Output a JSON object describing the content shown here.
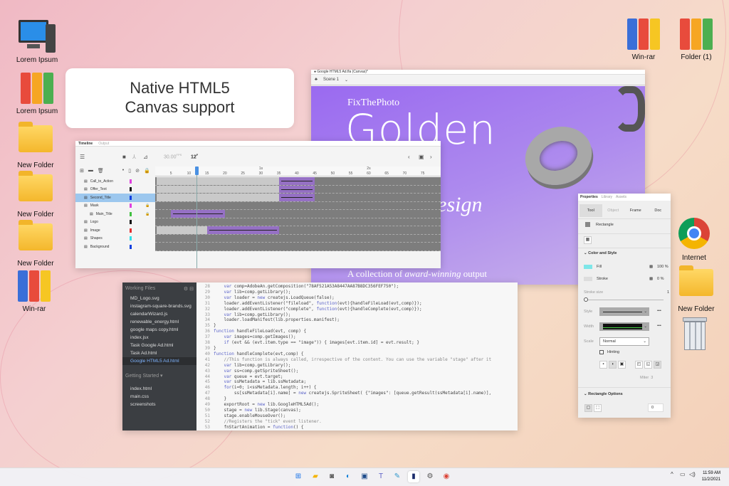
{
  "desktop": {
    "left_icons": [
      {
        "label": "Lorem Ipsum",
        "icon": "monitor-icon"
      },
      {
        "label": "Lorem Ipsum",
        "icon": "binders-icon"
      },
      {
        "label": "New Folder",
        "icon": "folder-icon"
      },
      {
        "label": "New Folder",
        "icon": "folder-icon"
      },
      {
        "label": "New Folder",
        "icon": "folder-icon"
      },
      {
        "label": "Win-rar",
        "icon": "winrar-icon"
      }
    ],
    "right_icons": [
      {
        "label": "Win-rar",
        "icon": "winrar-icon"
      },
      {
        "label": "Folder (1)",
        "icon": "binders-icon"
      },
      {
        "label": "Internet",
        "icon": "chrome-icon"
      },
      {
        "label": "New Folder",
        "icon": "folder-icon"
      },
      {
        "label": "",
        "icon": "trash-icon"
      }
    ]
  },
  "callout": {
    "line1": "Native HTML5",
    "line2": "Canvas support"
  },
  "canvas_window": {
    "title": "Google HTML5 Ad.fla (Canvas)*",
    "scene": "Scene 1",
    "art": {
      "brand": "FixThePhoto",
      "title1": "Golden",
      "title2": "Go",
      "title3": "Graphic Design",
      "subtitle_a": "A collection of ",
      "subtitle_b": "award-winning",
      "subtitle_c": " output"
    }
  },
  "timeline": {
    "tabs": [
      "Timeline",
      "Output"
    ],
    "fps": "30.00",
    "fps_unit": "FPS",
    "frame": "12",
    "frame_unit": "F",
    "current_frame": 12,
    "ruler_ticks": [
      5,
      10,
      15,
      20,
      25,
      30,
      35,
      40,
      45,
      50,
      55,
      60,
      65,
      70,
      75
    ],
    "seconds": [
      "1s",
      "2s"
    ],
    "layers": [
      {
        "name": "Call_to_Action",
        "color": "#e040e0",
        "light": [
          1,
          34
        ],
        "tween": [
          35,
          44
        ]
      },
      {
        "name": "Offer_Text",
        "color": "#111111",
        "light": [
          1,
          34
        ],
        "tween": [
          35,
          44
        ]
      },
      {
        "name": "Second_Title",
        "color": "#1040e0",
        "light": [
          1,
          34
        ],
        "tween": [
          35,
          44
        ],
        "selected": true
      },
      {
        "name": "Mask",
        "color": "#e040e0",
        "locked": true
      },
      {
        "name": "Main_Title",
        "color": "#40c040",
        "locked": true,
        "tween": [
          5,
          19
        ],
        "indent": true
      },
      {
        "name": "Logo",
        "color": "#111111"
      },
      {
        "name": "Image",
        "color": "#e03030",
        "light": [
          1,
          14
        ],
        "tween": [
          15,
          34
        ]
      },
      {
        "name": "Shapes",
        "color": "#30e0e8"
      },
      {
        "name": "Background",
        "color": "#1040e0"
      }
    ]
  },
  "code_editor": {
    "working_files_label": "Working Files",
    "files": [
      "MD_Logo.svg",
      "instagram-square-brands.svg",
      "calendarWizard.js",
      "renewable_energy.html",
      "google maps copy.html",
      "index.jsx",
      "Task Google Ad.html",
      "Task Ad.html",
      "Google HTML5 Ad.html"
    ],
    "selected_file": "Google HTML5 Ad.html",
    "getting_started_label": "Getting Started",
    "project_files": [
      "index.html",
      "main.css",
      "screenshots"
    ],
    "lines": [
      {
        "n": "28",
        "t": "    var comp=AdobeAn.getComposition(\"78AF521A53A8447AA87B8DC356FEF750\");"
      },
      {
        "n": "29",
        "t": "    var lib=comp.getLibrary();"
      },
      {
        "n": "30",
        "t": "    var loader = new createjs.LoadQueue(false);"
      },
      {
        "n": "31",
        "t": "    loader.addEventListener(\"fileload\", function(evt){handleFileLoad(evt,comp)});"
      },
      {
        "n": "32",
        "t": "    loader.addEventListener(\"complete\", function(evt){handleComplete(evt,comp)});"
      },
      {
        "n": "33",
        "t": "    var lib=comp.getLibrary();"
      },
      {
        "n": "34",
        "t": "    loader.loadManifest(lib.properties.manifest);"
      },
      {
        "n": "35",
        "t": "}"
      },
      {
        "n": "36",
        "t": "function handleFileLoad(evt, comp) {"
      },
      {
        "n": "37",
        "t": "    var images=comp.getImages();"
      },
      {
        "n": "38",
        "t": "    if (evt && (evt.item.type == \"image\")) { images[evt.item.id] = evt.result; }"
      },
      {
        "n": "39",
        "t": "}"
      },
      {
        "n": "40",
        "t": "function handleComplete(evt,comp) {"
      },
      {
        "n": "41",
        "t": "    //This function is always called, irrespective of the content. You can use the variable \"stage\" after it"
      },
      {
        "n": "42",
        "t": "    var lib=comp.getLibrary();"
      },
      {
        "n": "43",
        "t": "    var ss=comp.getSpriteSheet();"
      },
      {
        "n": "44",
        "t": "    var queue = evt.target;"
      },
      {
        "n": "45",
        "t": "    var ssMetadata = lib.ssMetadata;"
      },
      {
        "n": "46",
        "t": "    for(i=0; i<ssMetadata.length; i++) {"
      },
      {
        "n": "47",
        "t": "        ss[ssMetadata[i].name] = new createjs.SpriteSheet( {\"images\": [queue.getResult(ssMetadata[i].name)],"
      },
      {
        "n": "48",
        "t": "    }"
      },
      {
        "n": "49",
        "t": "    exportRoot = new lib.GoogleHTML5Ad();"
      },
      {
        "n": "50",
        "t": "    stage = new lib.Stage(canvas);"
      },
      {
        "n": "51",
        "t": "    stage.enableMouseOver();"
      },
      {
        "n": "52",
        "t": "    //Registers the \"tick\" event listener."
      },
      {
        "n": "53",
        "t": "    fnStartAnimation = function() {"
      }
    ]
  },
  "properties": {
    "tabs": [
      "Properties",
      "Library",
      "Assets"
    ],
    "subtabs": [
      "Tool",
      "Object",
      "Frame",
      "Doc"
    ],
    "tool_name": "Rectangle",
    "color_style_label": "Color and Style",
    "fill_label": "Fill",
    "fill_color": "#7ee6e8",
    "fill_alpha": "100 %",
    "stroke_label": "Stroke",
    "stroke_alpha": "0 %",
    "stroke_size_label": "Stroke size",
    "stroke_size": "1",
    "style_label": "Style",
    "width_label": "Width",
    "scale_label": "Scale",
    "scale_value": "Normal",
    "hinting_label": "Hinting",
    "miter_label": "Miter",
    "miter_value": "3",
    "rect_options_label": "Rectangle Options",
    "corner_value": "0"
  },
  "taskbar": {
    "apps": [
      "start",
      "file-explorer",
      "camera",
      "edge",
      "store",
      "teams",
      "paint",
      "animate",
      "settings",
      "chrome"
    ],
    "active": "animate",
    "time": "11:59 AM",
    "date": "11/2/2021"
  }
}
